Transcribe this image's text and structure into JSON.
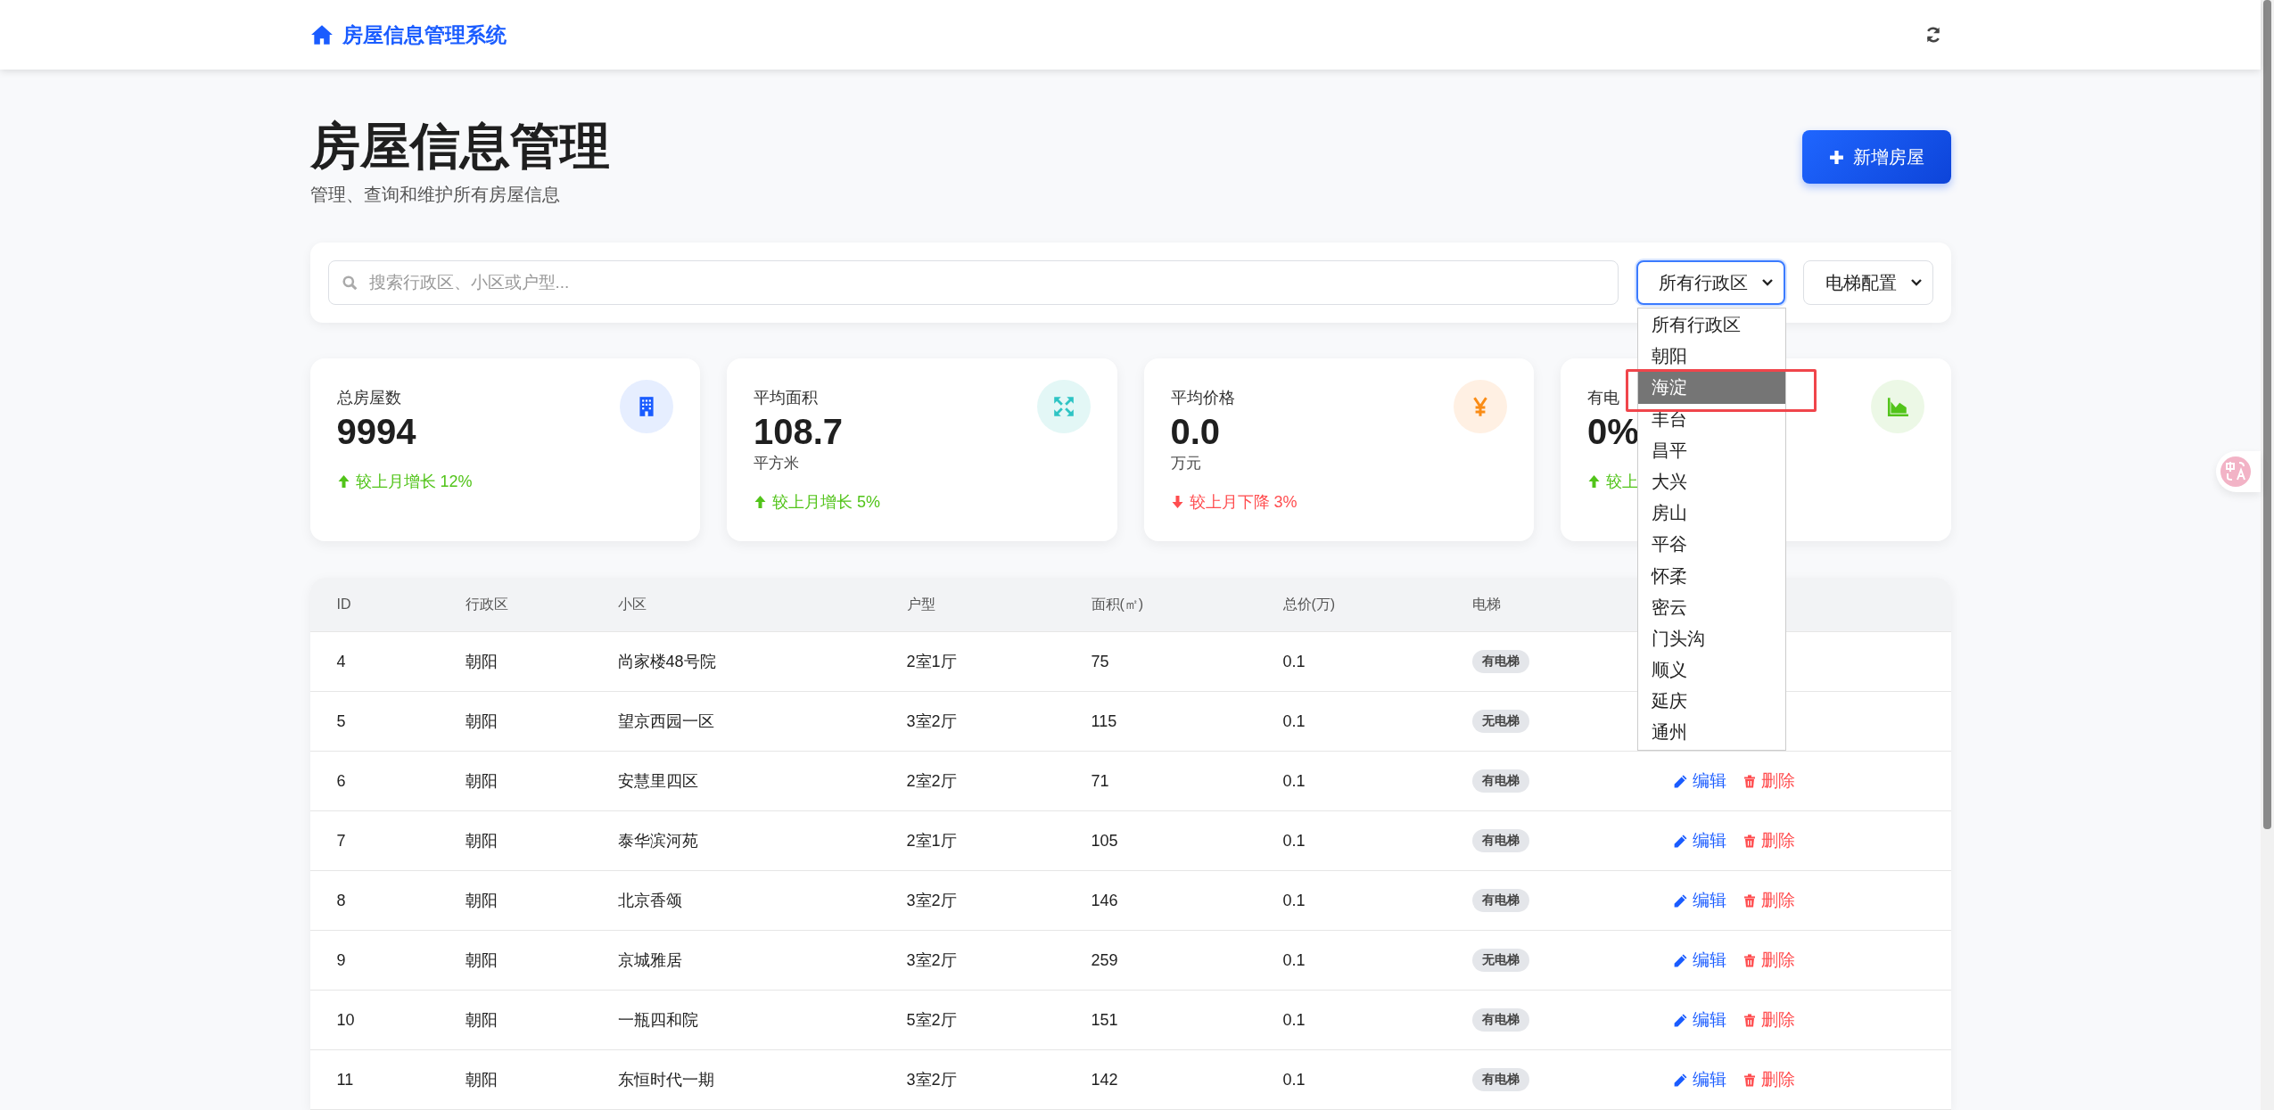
{
  "navbar": {
    "brand": "房屋信息管理系统"
  },
  "header": {
    "title": "房屋信息管理",
    "subtitle": "管理、查询和维护所有房屋信息",
    "button": "新增房屋"
  },
  "filters": {
    "search": {
      "placeholder": "搜索行政区、小区或户型..."
    },
    "district_select": {
      "value": "所有行政区",
      "focused": true,
      "expanded": true,
      "options": [
        {
          "label": "所有行政区",
          "highlighted": false,
          "annotated": false
        },
        {
          "label": "朝阳",
          "highlighted": false,
          "annotated": false
        },
        {
          "label": "海淀",
          "highlighted": true,
          "annotated": true
        },
        {
          "label": "丰台",
          "highlighted": false,
          "annotated": false
        },
        {
          "label": "昌平",
          "highlighted": false,
          "annotated": false
        },
        {
          "label": "大兴",
          "highlighted": false,
          "annotated": false
        },
        {
          "label": "房山",
          "highlighted": false,
          "annotated": false
        },
        {
          "label": "平谷",
          "highlighted": false,
          "annotated": false
        },
        {
          "label": "怀柔",
          "highlighted": false,
          "annotated": false
        },
        {
          "label": "密云",
          "highlighted": false,
          "annotated": false
        },
        {
          "label": "门头沟",
          "highlighted": false,
          "annotated": false
        },
        {
          "label": "顺义",
          "highlighted": false,
          "annotated": false
        },
        {
          "label": "延庆",
          "highlighted": false,
          "annotated": false
        },
        {
          "label": "通州",
          "highlighted": false,
          "annotated": false
        }
      ]
    },
    "elevator_select": {
      "value": "电梯配置",
      "focused": false
    }
  },
  "stats": [
    {
      "label": "总房屋数",
      "value": "9994",
      "kind": "building",
      "color": "#1a5cff",
      "trend": {
        "text": "较上月增长 12%",
        "rising": true
      }
    },
    {
      "label": "平均面积",
      "value": "108.7",
      "unit": "平方米",
      "kind": "expand",
      "color": "#2ec4c4",
      "trend": {
        "text": "较上月增长 5%",
        "rising": true
      }
    },
    {
      "label": "平均价格",
      "value": "0.0",
      "unit": "万元",
      "kind": "yen",
      "color": "#fa8c16",
      "trend": {
        "text": "较上月下降 3%",
        "rising": false
      }
    },
    {
      "label": "有电",
      "value": "0%",
      "kind": "chart",
      "color": "#52c41a",
      "trend": {
        "text": "较上",
        "rising": true
      }
    }
  ],
  "table": {
    "columns": [
      "ID",
      "行政区",
      "小区",
      "户型",
      "面积(㎡)",
      "总价(万)",
      "电梯"
    ],
    "rows": [
      {
        "cells": [
          "4",
          "朝阳",
          "尚家楼48号院",
          "2室1厅",
          "75",
          "0.1"
        ],
        "elevator": "有电梯"
      },
      {
        "cells": [
          "5",
          "朝阳",
          "望京西园一区",
          "3室2厅",
          "115",
          "0.1"
        ],
        "elevator": "无电梯"
      },
      {
        "cells": [
          "6",
          "朝阳",
          "安慧里四区",
          "2室2厅",
          "71",
          "0.1"
        ],
        "elevator": "有电梯",
        "actions": [
          {
            "label": "编辑",
            "kind": "edit"
          },
          {
            "label": "删除",
            "kind": "delete"
          }
        ]
      },
      {
        "cells": [
          "7",
          "朝阳",
          "泰华滨河苑",
          "2室1厅",
          "105",
          "0.1"
        ],
        "elevator": "有电梯",
        "actions": [
          {
            "label": "编辑",
            "kind": "edit"
          },
          {
            "label": "删除",
            "kind": "delete"
          }
        ]
      },
      {
        "cells": [
          "8",
          "朝阳",
          "北京香颂",
          "3室2厅",
          "146",
          "0.1"
        ],
        "elevator": "有电梯",
        "actions": [
          {
            "label": "编辑",
            "kind": "edit"
          },
          {
            "label": "删除",
            "kind": "delete"
          }
        ]
      },
      {
        "cells": [
          "9",
          "朝阳",
          "京城雅居",
          "3室2厅",
          "259",
          "0.1"
        ],
        "elevator": "无电梯",
        "actions": [
          {
            "label": "编辑",
            "kind": "edit"
          },
          {
            "label": "删除",
            "kind": "delete"
          }
        ]
      },
      {
        "cells": [
          "10",
          "朝阳",
          "一瓶四和院",
          "5室2厅",
          "151",
          "0.1"
        ],
        "elevator": "有电梯",
        "actions": [
          {
            "label": "编辑",
            "kind": "edit"
          },
          {
            "label": "删除",
            "kind": "delete"
          }
        ]
      },
      {
        "cells": [
          "11",
          "朝阳",
          "东恒时代一期",
          "3室2厅",
          "142",
          "0.1"
        ],
        "elevator": "有电梯",
        "actions": [
          {
            "label": "编辑",
            "kind": "edit"
          },
          {
            "label": "删除",
            "kind": "delete"
          }
        ]
      }
    ]
  }
}
